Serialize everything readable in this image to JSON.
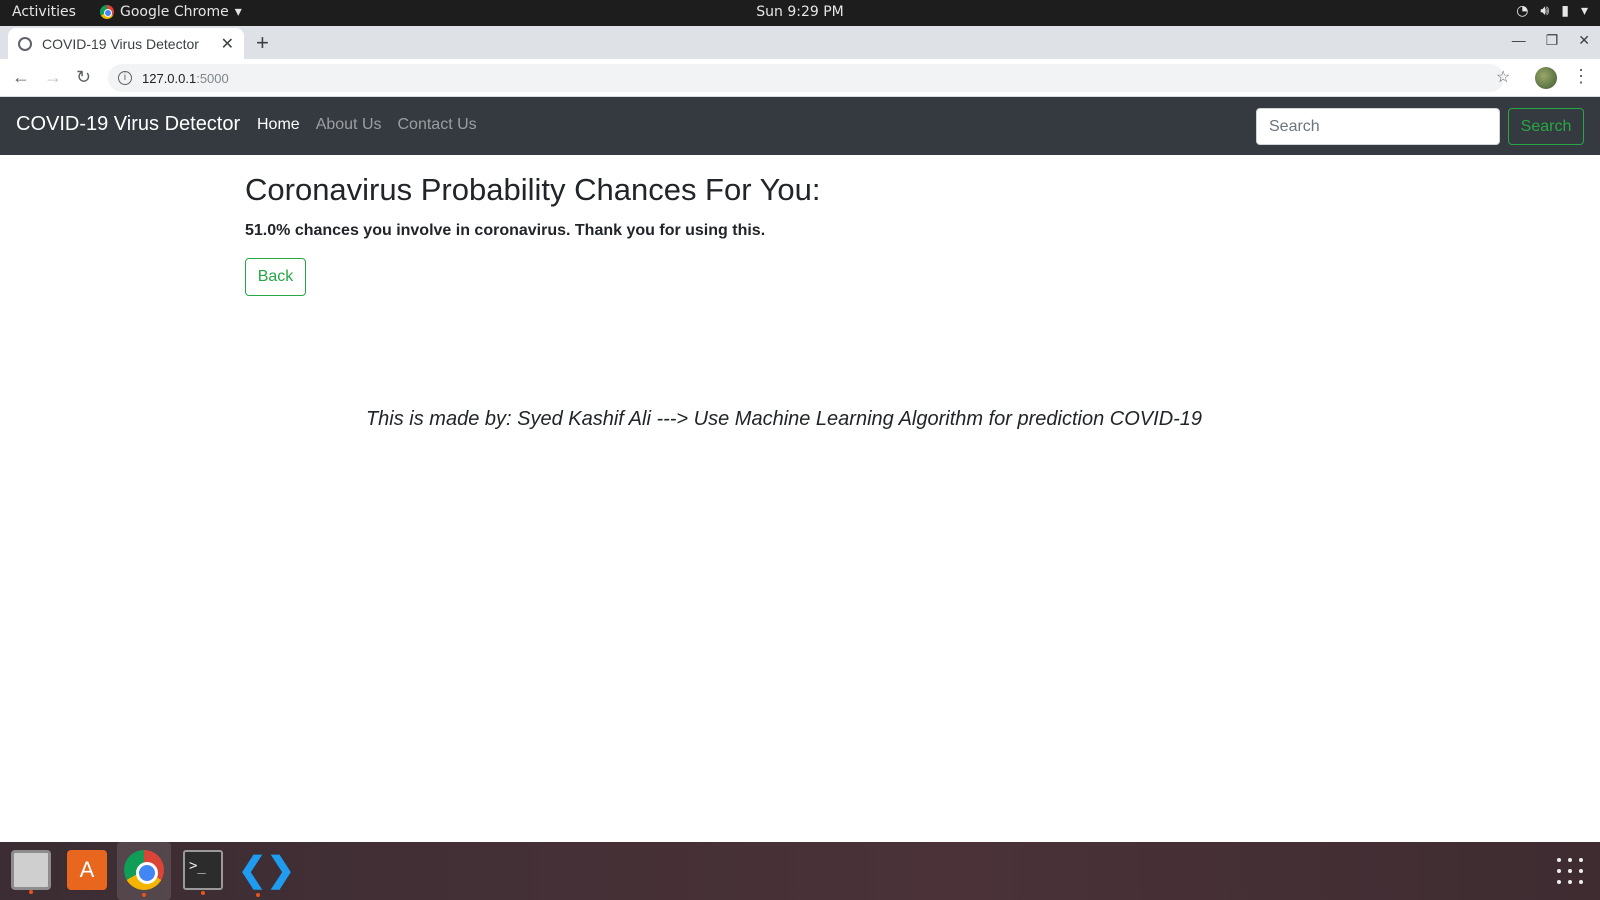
{
  "system_bar": {
    "activities": "Activities",
    "app_name": "Google Chrome",
    "clock": "Sun  9:29 PM"
  },
  "browser": {
    "tab_title": "COVID-19 Virus Detector",
    "url_host": "127.0.0.1",
    "url_port": ":5000"
  },
  "navbar": {
    "brand": "COVID-19 Virus Detector",
    "links": [
      "Home",
      "About Us",
      "Contact Us"
    ],
    "search_placeholder": "Search",
    "search_button": "Search"
  },
  "main": {
    "heading": "Coronavirus Probability Chances For You:",
    "result": "51.0% chances you involve in coronavirus. Thank you for using this.",
    "back_button": "Back",
    "credit": "This is made by: Syed Kashif Ali ---> Use Machine Learning Algorithm for prediction COVID-19"
  },
  "colors": {
    "navbar_bg": "#343a40",
    "success": "#28a745"
  }
}
